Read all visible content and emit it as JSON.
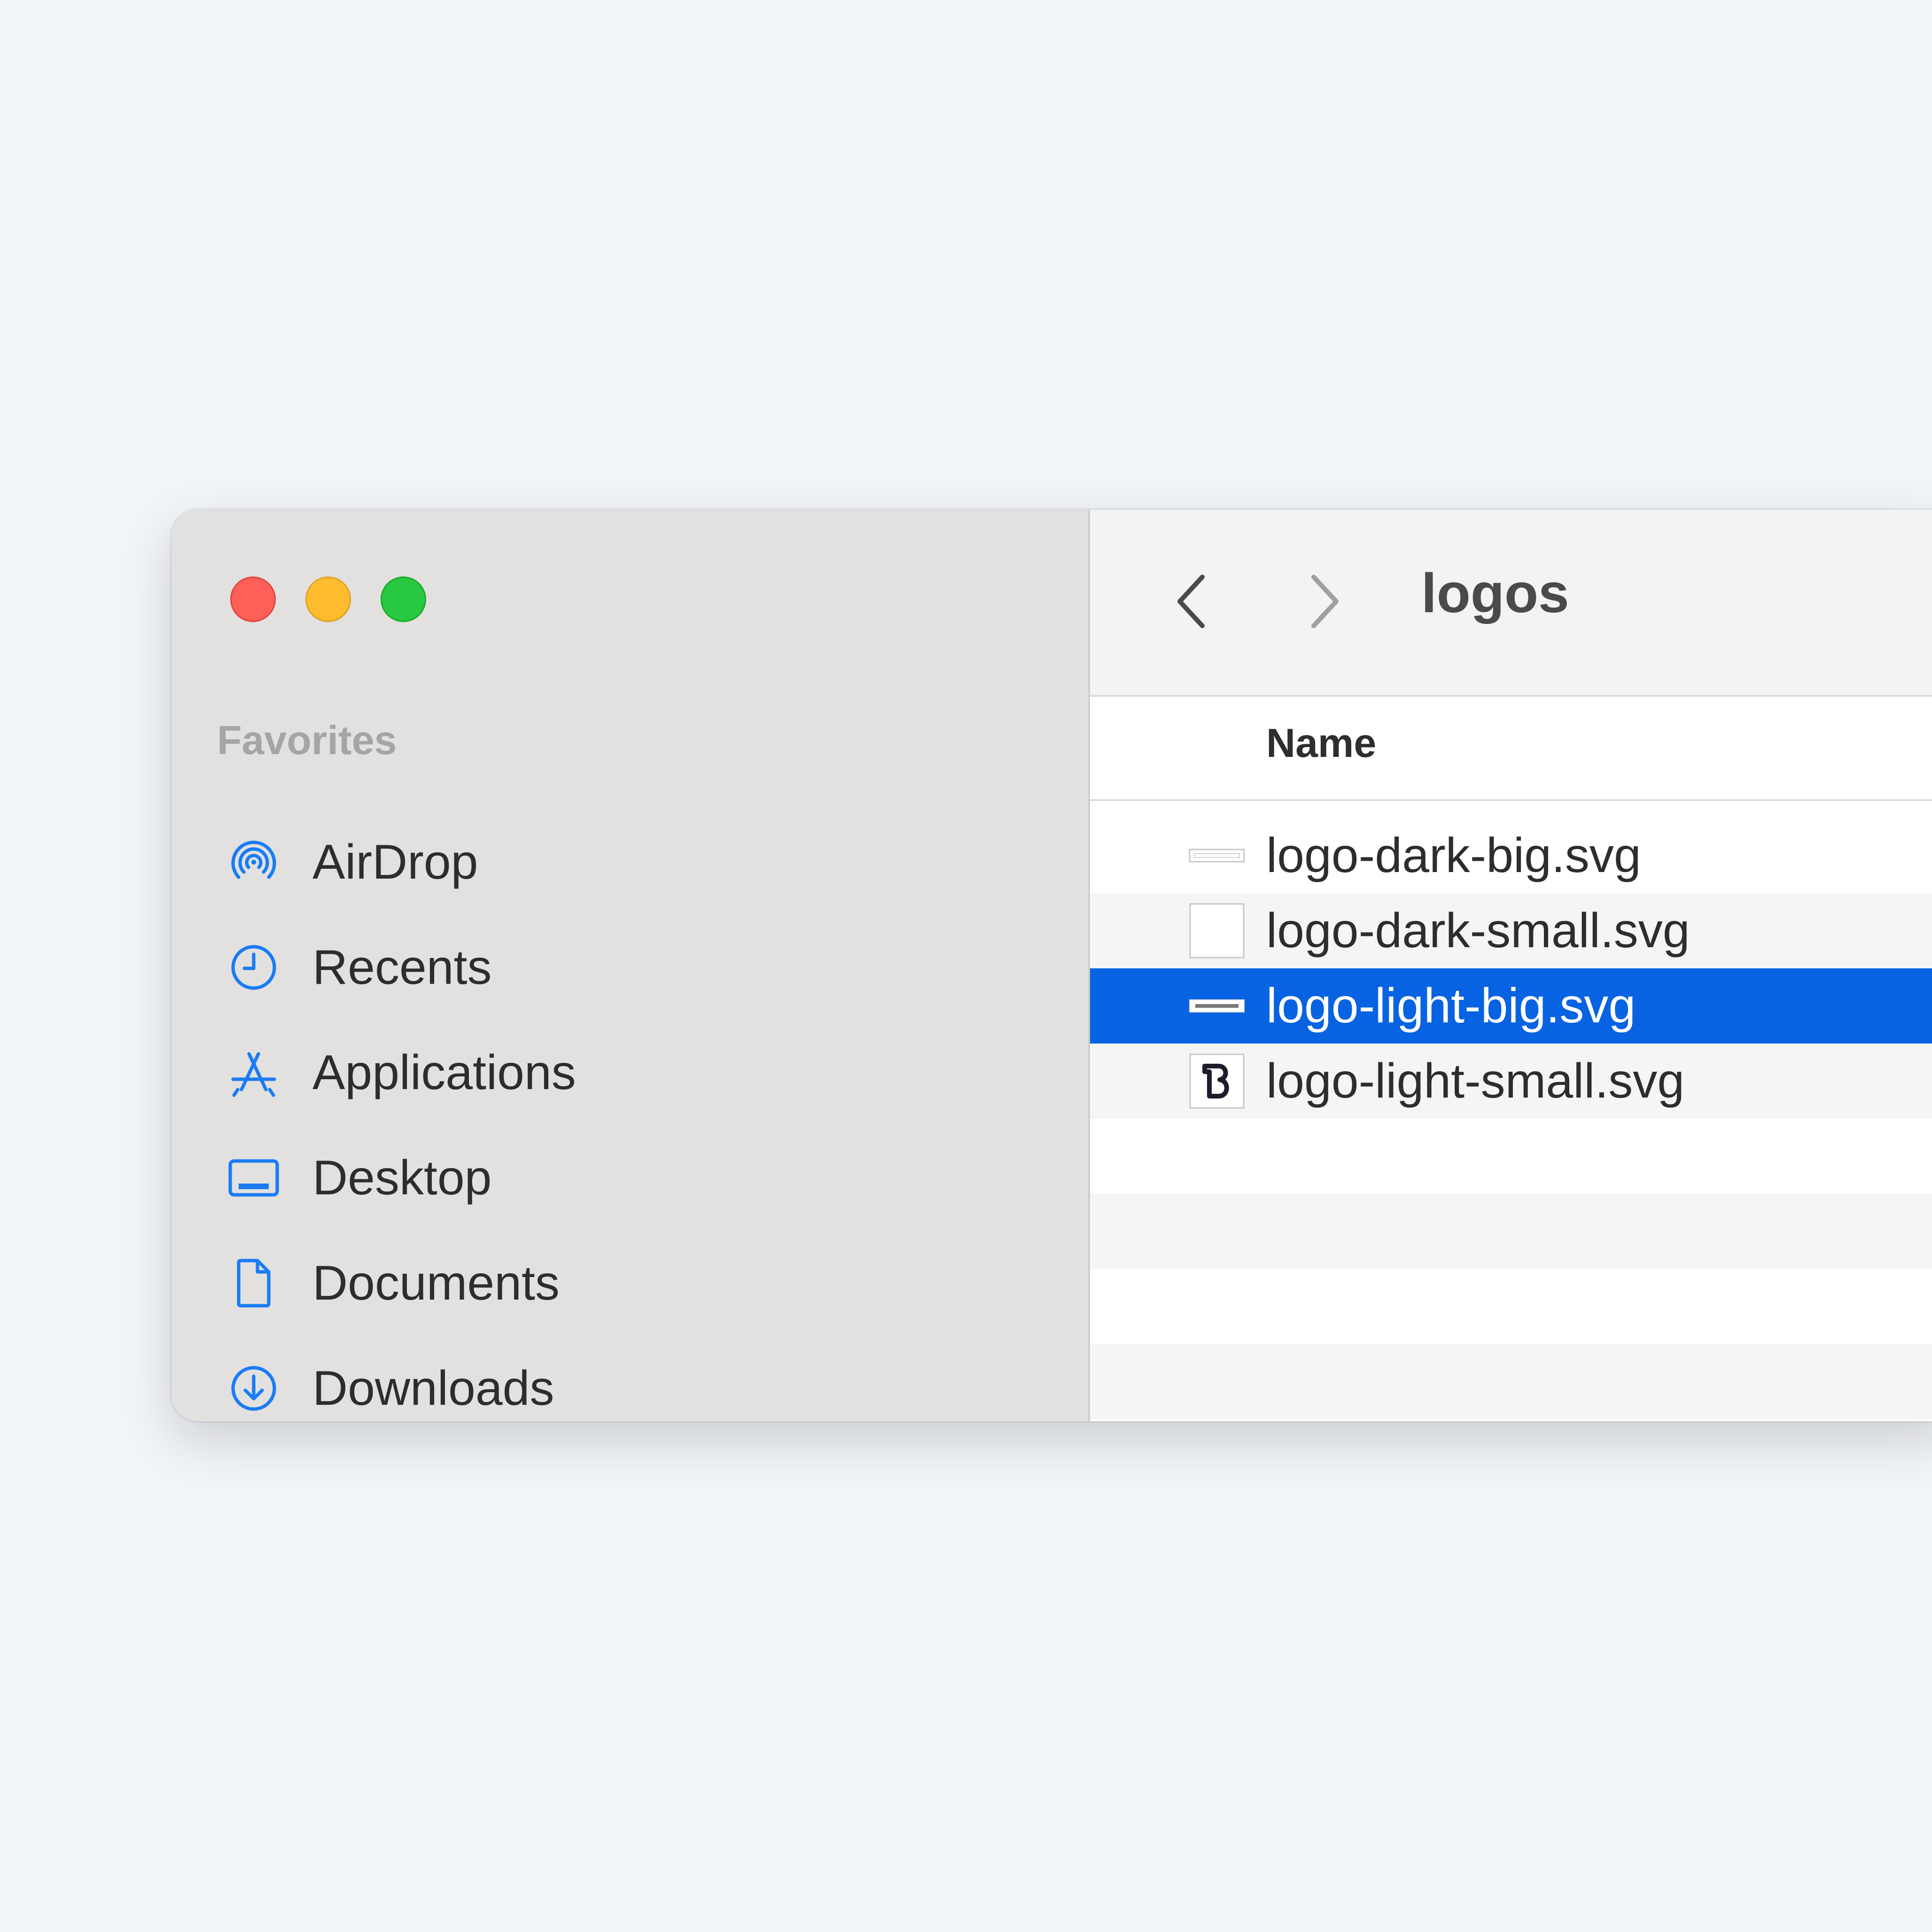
{
  "window": {
    "controls": {
      "close": "close-button",
      "minimize": "minimize-button",
      "zoom": "zoom-button"
    }
  },
  "sidebar": {
    "section_title": "Favorites",
    "items": [
      {
        "label": "AirDrop",
        "icon": "airdrop-icon"
      },
      {
        "label": "Recents",
        "icon": "clock-icon"
      },
      {
        "label": "Applications",
        "icon": "applications-icon"
      },
      {
        "label": "Desktop",
        "icon": "desktop-icon"
      },
      {
        "label": "Documents",
        "icon": "document-icon"
      },
      {
        "label": "Downloads",
        "icon": "download-icon"
      }
    ]
  },
  "toolbar": {
    "folder_title": "logos",
    "back_icon": "chevron-left-icon",
    "forward_icon": "chevron-right-icon"
  },
  "file_list": {
    "column_name": "Name",
    "files": [
      {
        "name": "logo-dark-big.svg",
        "selected": false
      },
      {
        "name": "logo-dark-small.svg",
        "selected": false
      },
      {
        "name": "logo-light-big.svg",
        "selected": true
      },
      {
        "name": "logo-light-small.svg",
        "selected": false
      }
    ]
  },
  "colors": {
    "accent": "#0863e2",
    "sidebar_icon": "#1a7cf5",
    "background": "#f2f5f8",
    "sidebar_bg": "#e2e1e0"
  }
}
